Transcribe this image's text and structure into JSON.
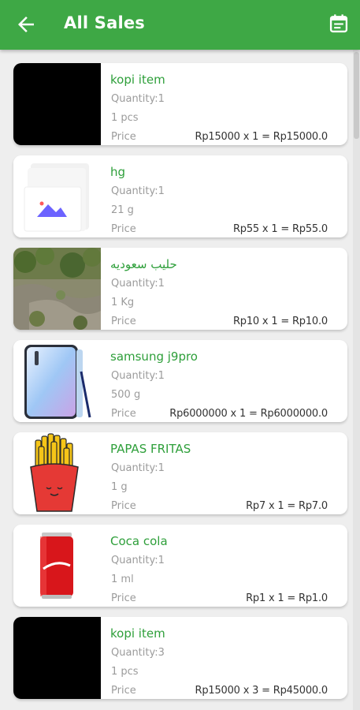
{
  "appbar": {
    "title": "All Sales",
    "back_icon": "arrow-left-icon",
    "calendar_icon": "calendar-icon",
    "color": "#3ea845"
  },
  "labels": {
    "price": "Price"
  },
  "sales": [
    {
      "name": "kopi item",
      "quantity": "Quantity:1",
      "unit": "1 pcs",
      "calc": "Rp15000 x 1 = Rp15000.0",
      "image": "black-placeholder"
    },
    {
      "name": "hg",
      "quantity": "Quantity:1",
      "unit": "21 g",
      "calc": "Rp55 x 1 = Rp55.0",
      "image": "image-placeholder-icon"
    },
    {
      "name": "حليب سعوديه",
      "quantity": "Quantity:1",
      "unit": "1 Kg",
      "calc": "Rp10 x 1 = Rp10.0",
      "image": "landscape-photo"
    },
    {
      "name": "samsung j9pro",
      "quantity": "Quantity:1",
      "unit": "500 g",
      "calc": "Rp6000000 x 1 = Rp6000000.0",
      "image": "smartphone-photo"
    },
    {
      "name": "PAPAS FRITAS",
      "quantity": "Quantity:1",
      "unit": "1 g",
      "calc": "Rp7 x 1 = Rp7.0",
      "image": "french-fries-illustration"
    },
    {
      "name": "Coca cola",
      "quantity": "Quantity:1",
      "unit": "1 ml",
      "calc": "Rp1 x 1 = Rp1.0",
      "image": "cola-can-photo"
    },
    {
      "name": "kopi item",
      "quantity": "Quantity:3",
      "unit": "1 pcs",
      "calc": "Rp15000 x 3 = Rp45000.0",
      "image": "black-placeholder"
    }
  ]
}
